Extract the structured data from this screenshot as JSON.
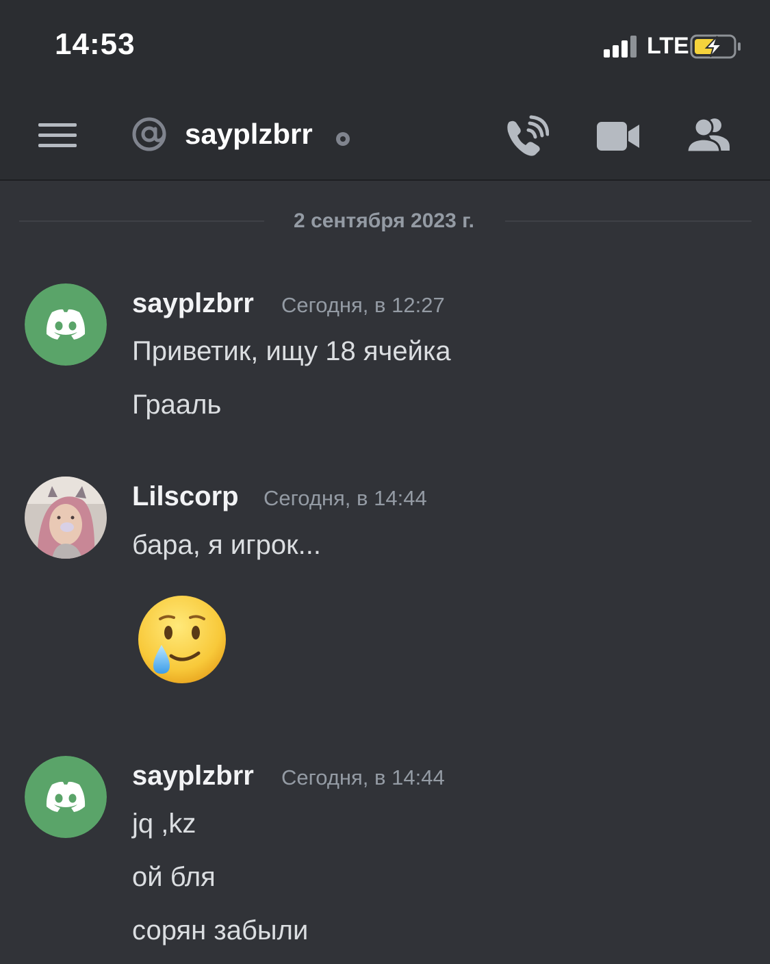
{
  "status_bar": {
    "time": "14:53",
    "network": "LTE"
  },
  "header": {
    "channel_name": "sayplzbrr"
  },
  "date_divider": "2 сентября 2023 г.",
  "messages": [
    {
      "author": "sayplzbrr",
      "timestamp": "Сегодня, в 12:27",
      "lines": [
        "Приветик, ищу 18 ячейка",
        "Грааль"
      ]
    },
    {
      "author": "Lilscorp",
      "timestamp": "Сегодня, в 14:44",
      "lines": [
        "бара, я игрок..."
      ],
      "emoji": "smiling-face-with-tear"
    },
    {
      "author": "sayplzbrr",
      "timestamp": "Сегодня, в 14:44",
      "lines": [
        "jq ,kz",
        "ой бля",
        "сорян забыли"
      ]
    }
  ],
  "colors": {
    "background": "#313338",
    "header": "#2b2d31",
    "discord_green_avatar": "#5aa469",
    "muted_text": "#949ba4",
    "battery_charge": "#f5d33c"
  }
}
